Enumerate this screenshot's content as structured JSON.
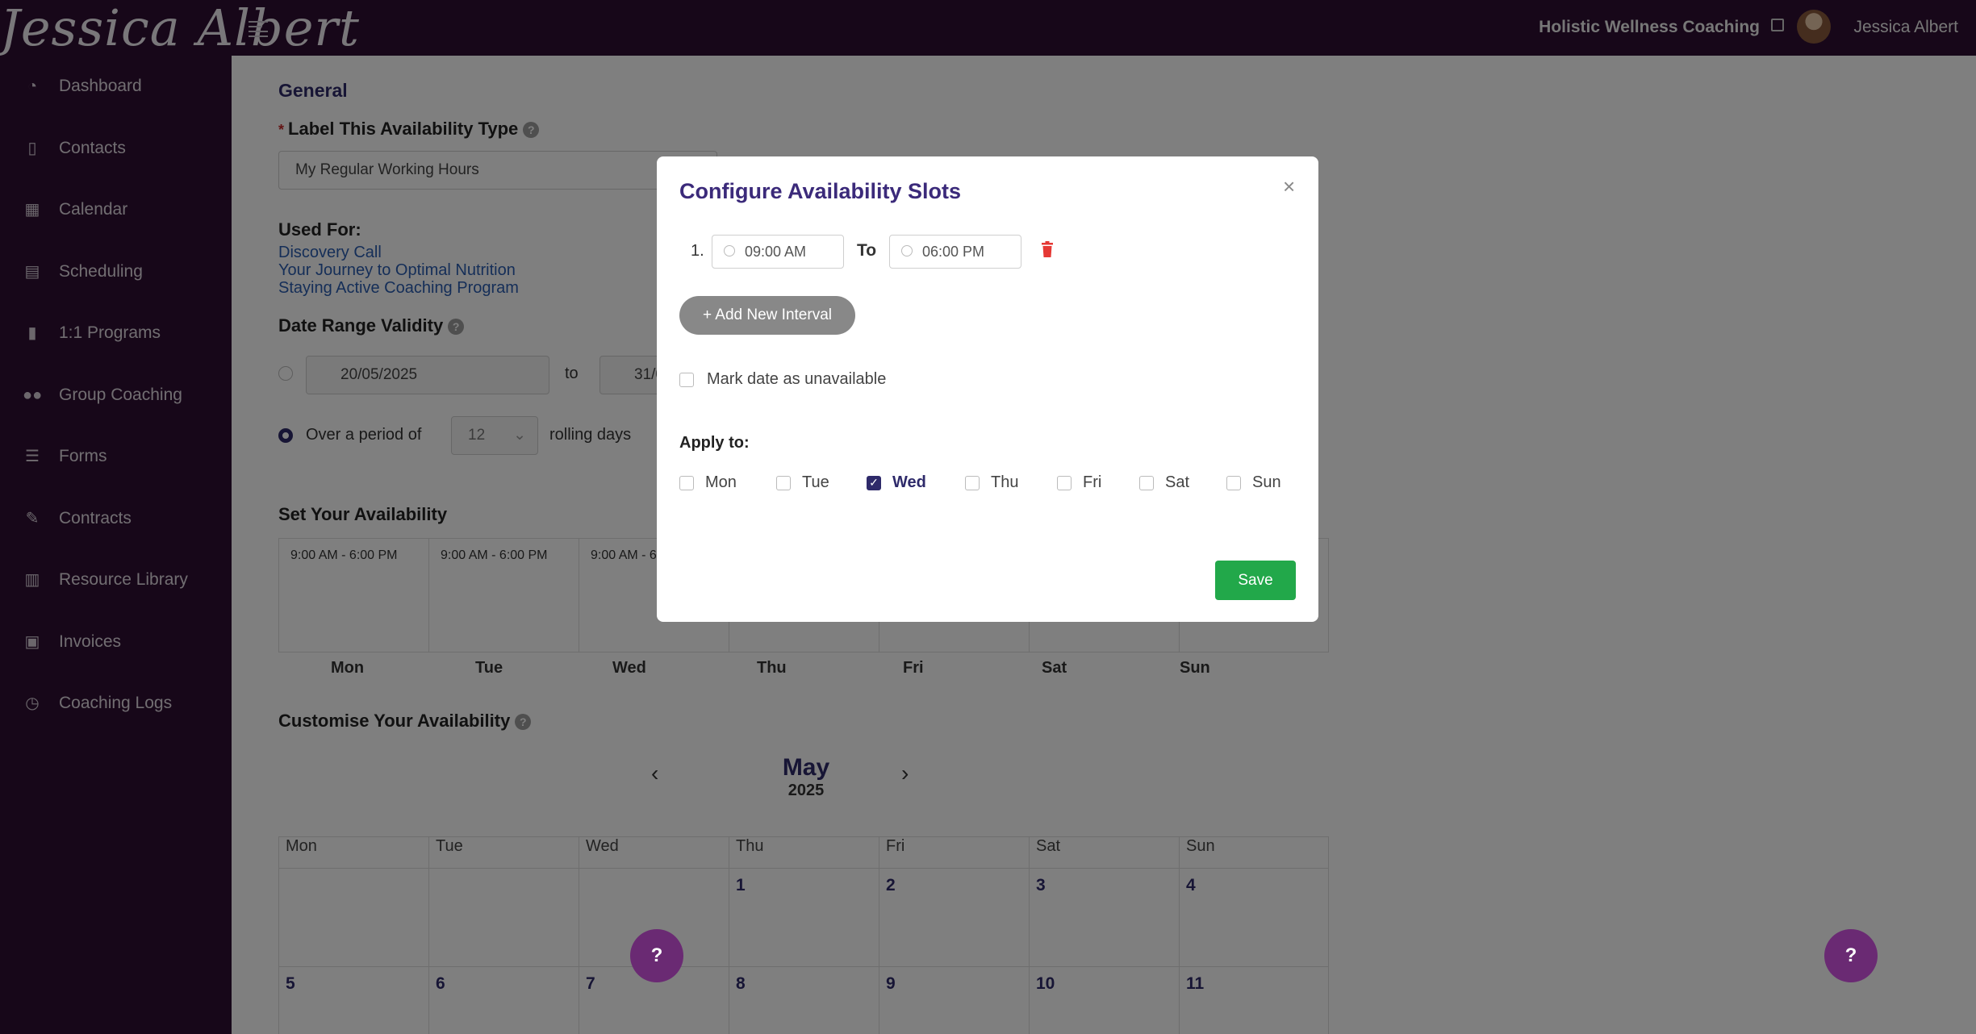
{
  "topbar": {
    "logo_text": "Jessica Albert",
    "business_name": "Holistic Wellness Coaching",
    "user_name": "Jessica Albert"
  },
  "sidebar": {
    "items": [
      {
        "label": "Dashboard",
        "icon": "dashboard-icon"
      },
      {
        "label": "Contacts",
        "icon": "contacts-icon"
      },
      {
        "label": "Calendar",
        "icon": "calendar-icon"
      },
      {
        "label": "Scheduling",
        "icon": "scheduling-icon"
      },
      {
        "label": "1:1 Programs",
        "icon": "book-icon"
      },
      {
        "label": "Group Coaching",
        "icon": "group-icon"
      },
      {
        "label": "Forms",
        "icon": "forms-icon"
      },
      {
        "label": "Contracts",
        "icon": "contract-icon"
      },
      {
        "label": "Resource Library",
        "icon": "library-icon"
      },
      {
        "label": "Invoices",
        "icon": "invoice-icon"
      },
      {
        "label": "Coaching Logs",
        "icon": "clock-icon"
      }
    ]
  },
  "main": {
    "general_heading": "General",
    "label_question": "Label This Availability Type",
    "label_value": "My Regular Working Hours",
    "used_for_heading": "Used For:",
    "used_for_links": [
      "Discovery Call",
      "Your Journey to Optimal Nutrition",
      "Staying Active Coaching Program"
    ],
    "date_range_heading": "Date Range Validity",
    "start_date": "20/05/2025",
    "to_label": "to",
    "end_date_partial": "31/0",
    "over_period_label": "Over a period of",
    "period_value": "12",
    "rolling_days_label": "rolling days",
    "set_heading": "Set Your Availability",
    "slots": [
      "9:00 AM - 6:00 PM",
      "9:00 AM - 6:00 PM",
      "9:00 AM - 6"
    ],
    "weekdays": [
      "Mon",
      "Tue",
      "Wed",
      "Thu",
      "Fri",
      "Sat",
      "Sun"
    ],
    "customise_heading": "Customise Your Availability",
    "calendar": {
      "month": "May",
      "year": "2025",
      "row1": [
        "",
        "",
        "",
        "1",
        "2",
        "3",
        "4"
      ],
      "row2": [
        "5",
        "6",
        "7",
        "8",
        "9",
        "10",
        "11"
      ]
    }
  },
  "modal": {
    "title": "Configure Availability Slots",
    "close_glyph": "×",
    "interval_index": "1.",
    "start_time": "09:00 AM",
    "to_label": "To",
    "end_time": "06:00 PM",
    "add_interval_label": "+ Add New Interval",
    "unavailable_label": "Mark date as unavailable",
    "apply_to_heading": "Apply to:",
    "days": [
      {
        "label": "Mon",
        "checked": false
      },
      {
        "label": "Tue",
        "checked": false
      },
      {
        "label": "Wed",
        "checked": true
      },
      {
        "label": "Thu",
        "checked": false
      },
      {
        "label": "Fri",
        "checked": false
      },
      {
        "label": "Sat",
        "checked": false
      },
      {
        "label": "Sun",
        "checked": false
      }
    ],
    "save_label": "Save"
  },
  "help_fab_label": "?",
  "colors": {
    "sidebar_bg": "#2f0f33",
    "accent": "#2e2a6a",
    "save_green": "#22a84a",
    "fab_purple": "#6a2a73"
  }
}
